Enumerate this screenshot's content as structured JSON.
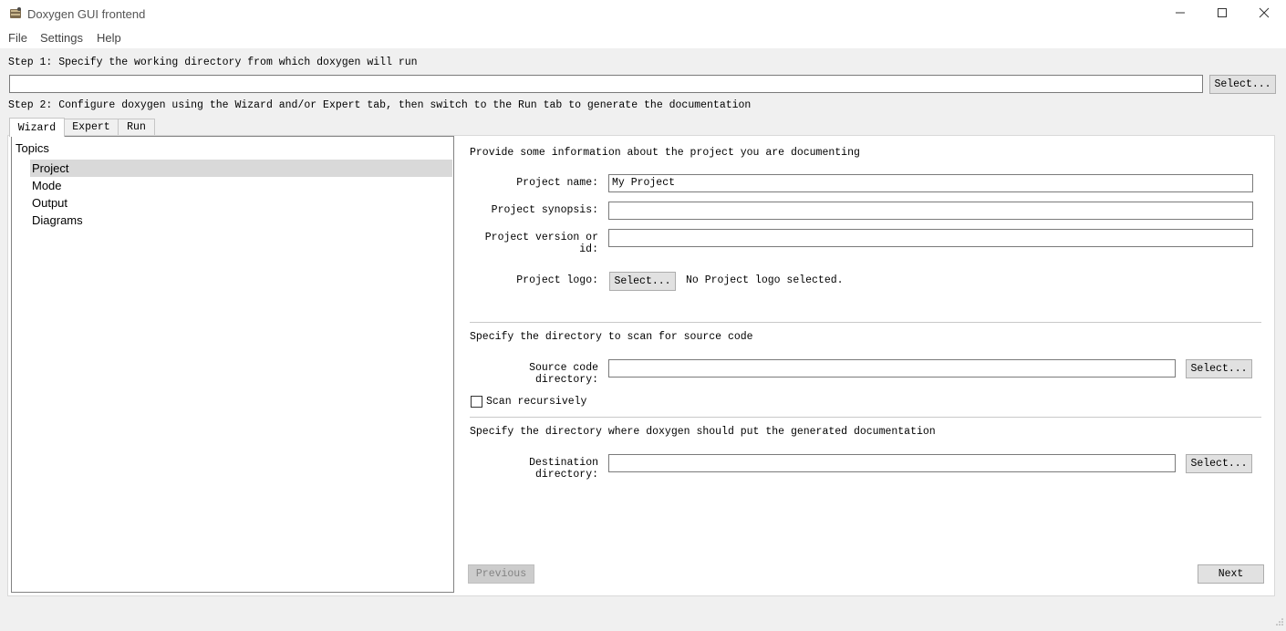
{
  "window": {
    "title": "Doxygen GUI frontend",
    "controls": [
      "minimize",
      "maximize",
      "close"
    ]
  },
  "menu": [
    "File",
    "Settings",
    "Help"
  ],
  "step1": {
    "label": "Step 1: Specify the working directory from which doxygen will run",
    "value": "",
    "button": "Select..."
  },
  "step2": {
    "label": "Step 2: Configure doxygen using the Wizard and/or Expert tab, then switch to the Run tab to generate the documentation"
  },
  "tabs": [
    "Wizard",
    "Expert",
    "Run"
  ],
  "active_tab": "Wizard",
  "topics": {
    "header": "Topics",
    "items": [
      "Project",
      "Mode",
      "Output",
      "Diagrams"
    ],
    "selected": "Project"
  },
  "project": {
    "intro": "Provide some information about the project you are documenting",
    "name_label": "Project name:",
    "name_value": "My Project",
    "synopsis_label": "Project synopsis:",
    "synopsis_value": "",
    "version_label": "Project version or id:",
    "version_value": "",
    "logo_label": "Project logo:",
    "logo_button": "Select...",
    "logo_status": "No Project logo selected."
  },
  "source": {
    "intro": "Specify the directory to scan for source code",
    "dir_label": "Source code directory:",
    "dir_value": "",
    "button": "Select...",
    "recursive_label": "Scan recursively",
    "recursive_checked": false
  },
  "destination": {
    "intro": "Specify the directory where doxygen should put the generated documentation",
    "dir_label": "Destination directory:",
    "dir_value": "",
    "button": "Select..."
  },
  "nav": {
    "previous": "Previous",
    "next": "Next"
  }
}
